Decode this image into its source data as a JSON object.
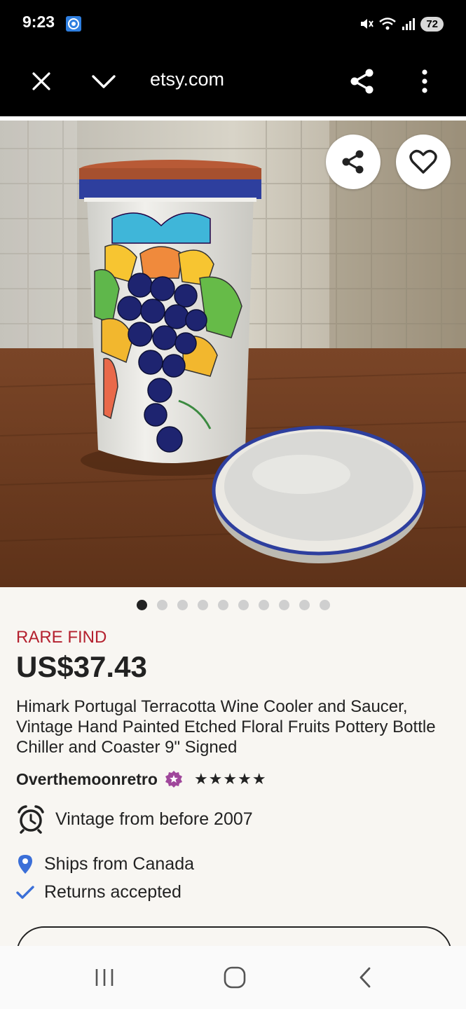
{
  "status_bar": {
    "time": "9:23",
    "battery": "72"
  },
  "toolbar": {
    "url": "etsy.com"
  },
  "carousel": {
    "total_images": 10,
    "active_index": 0
  },
  "listing": {
    "badge": "RARE FIND",
    "price": "US$37.43",
    "title": "Himark Portugal Terracotta Wine Cooler and Saucer, Vintage Hand Painted Etched Floral Fruits Pottery Bottle Chiller and Coaster 9\" Signed",
    "shop_name": "Overthemoonretro",
    "stars": "★★★★★",
    "rating": 5,
    "vintage_note": "Vintage from before 2007",
    "ships_from": "Ships from Canada",
    "returns": "Returns accepted"
  },
  "colors": {
    "badge_red": "#b4212f",
    "star_seller_purple": "#a0479b",
    "location_blue": "#3b6fd8",
    "check_blue": "#3b6fd8"
  },
  "icons": [
    "close-icon",
    "chevron-down-icon",
    "share-icon",
    "more-vert-icon",
    "heart-icon",
    "alarm-clock-icon",
    "location-pin-icon",
    "check-icon",
    "star-seller-icon"
  ]
}
